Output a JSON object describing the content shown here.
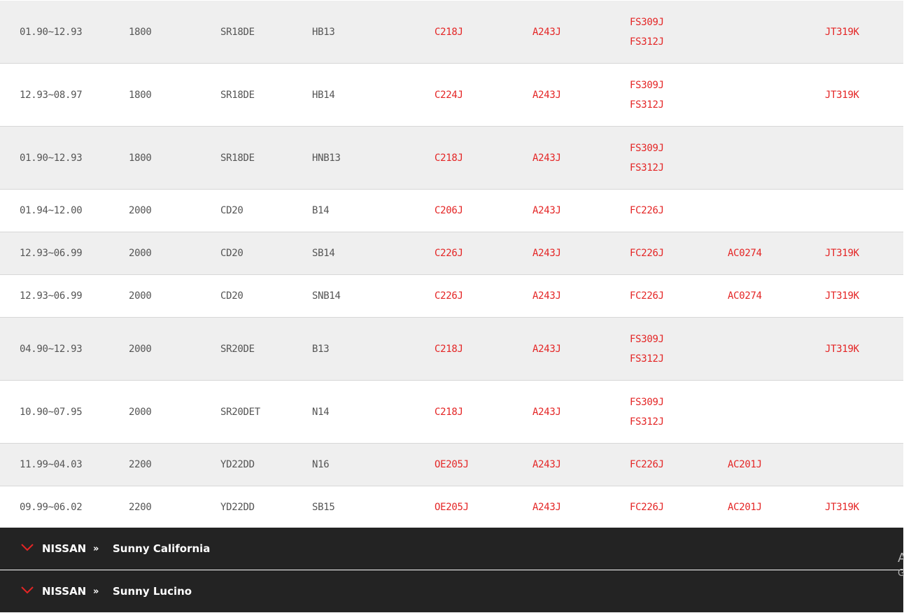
{
  "rows": [
    {
      "date": "01.90~12.93",
      "cc": "1800",
      "engine": "SR18DE",
      "body": "HB13",
      "parts": [
        [
          "C218J"
        ],
        [
          "A243J"
        ],
        [
          "FS309J",
          "FS312J"
        ],
        [],
        [
          "JT319K"
        ]
      ]
    },
    {
      "date": "12.93~08.97",
      "cc": "1800",
      "engine": "SR18DE",
      "body": "HB14",
      "parts": [
        [
          "C224J"
        ],
        [
          "A243J"
        ],
        [
          "FS309J",
          "FS312J"
        ],
        [],
        [
          "JT319K"
        ]
      ]
    },
    {
      "date": "01.90~12.93",
      "cc": "1800",
      "engine": "SR18DE",
      "body": "HNB13",
      "parts": [
        [
          "C218J"
        ],
        [
          "A243J"
        ],
        [
          "FS309J",
          "FS312J"
        ],
        [],
        []
      ]
    },
    {
      "date": "01.94~12.00",
      "cc": "2000",
      "engine": "CD20",
      "body": "B14",
      "parts": [
        [
          "C206J"
        ],
        [
          "A243J"
        ],
        [
          "FC226J"
        ],
        [],
        []
      ]
    },
    {
      "date": "12.93~06.99",
      "cc": "2000",
      "engine": "CD20",
      "body": "SB14",
      "parts": [
        [
          "C226J"
        ],
        [
          "A243J"
        ],
        [
          "FC226J"
        ],
        [
          "AC0274"
        ],
        [
          "JT319K"
        ]
      ]
    },
    {
      "date": "12.93~06.99",
      "cc": "2000",
      "engine": "CD20",
      "body": "SNB14",
      "parts": [
        [
          "C226J"
        ],
        [
          "A243J"
        ],
        [
          "FC226J"
        ],
        [
          "AC0274"
        ],
        [
          "JT319K"
        ]
      ]
    },
    {
      "date": "04.90~12.93",
      "cc": "2000",
      "engine": "SR20DE",
      "body": "B13",
      "parts": [
        [
          "C218J"
        ],
        [
          "A243J"
        ],
        [
          "FS309J",
          "FS312J"
        ],
        [],
        [
          "JT319K"
        ]
      ]
    },
    {
      "date": "10.90~07.95",
      "cc": "2000",
      "engine": "SR20DET",
      "body": "N14",
      "parts": [
        [
          "C218J"
        ],
        [
          "A243J"
        ],
        [
          "FS309J",
          "FS312J"
        ],
        [],
        []
      ]
    },
    {
      "date": "11.99~04.03",
      "cc": "2200",
      "engine": "YD22DD",
      "body": "N16",
      "parts": [
        [
          "OE205J"
        ],
        [
          "A243J"
        ],
        [
          "FC226J"
        ],
        [
          "AC201J"
        ],
        []
      ]
    },
    {
      "date": "09.99~06.02",
      "cc": "2200",
      "engine": "YD22DD",
      "body": "SB15",
      "parts": [
        [
          "OE205J"
        ],
        [
          "A243J"
        ],
        [
          "FC226J"
        ],
        [
          "AC201J"
        ],
        [
          "JT319K"
        ]
      ]
    }
  ],
  "accordions": [
    {
      "make": "NISSAN",
      "separator": "»",
      "model": "Sunny California"
    },
    {
      "make": "NISSAN",
      "separator": "»",
      "model": "Sunny Lucino"
    }
  ],
  "edge_text": {
    "line1": "A",
    "line2": "G"
  },
  "colors": {
    "code_red": "#e42525",
    "text_gray": "#555555",
    "row_alt": "#efefef",
    "accordion_bg": "#232323"
  },
  "icons": {
    "accordion_toggle": "chevron-down-icon"
  }
}
